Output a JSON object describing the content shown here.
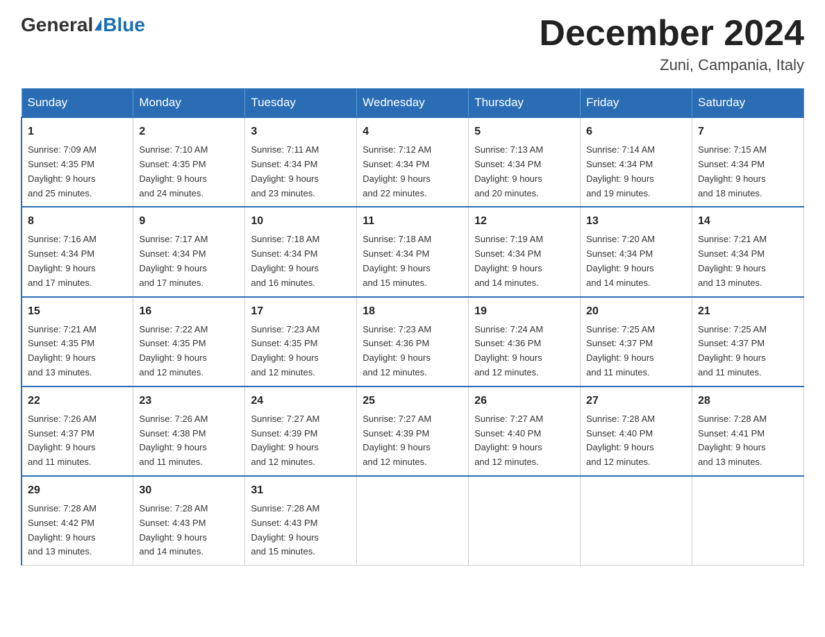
{
  "logo": {
    "general": "General",
    "blue": "Blue"
  },
  "header": {
    "month": "December 2024",
    "location": "Zuni, Campania, Italy"
  },
  "weekdays": [
    "Sunday",
    "Monday",
    "Tuesday",
    "Wednesday",
    "Thursday",
    "Friday",
    "Saturday"
  ],
  "weeks": [
    [
      {
        "day": "1",
        "sunrise": "7:09 AM",
        "sunset": "4:35 PM",
        "daylight": "9 hours and 25 minutes."
      },
      {
        "day": "2",
        "sunrise": "7:10 AM",
        "sunset": "4:35 PM",
        "daylight": "9 hours and 24 minutes."
      },
      {
        "day": "3",
        "sunrise": "7:11 AM",
        "sunset": "4:34 PM",
        "daylight": "9 hours and 23 minutes."
      },
      {
        "day": "4",
        "sunrise": "7:12 AM",
        "sunset": "4:34 PM",
        "daylight": "9 hours and 22 minutes."
      },
      {
        "day": "5",
        "sunrise": "7:13 AM",
        "sunset": "4:34 PM",
        "daylight": "9 hours and 20 minutes."
      },
      {
        "day": "6",
        "sunrise": "7:14 AM",
        "sunset": "4:34 PM",
        "daylight": "9 hours and 19 minutes."
      },
      {
        "day": "7",
        "sunrise": "7:15 AM",
        "sunset": "4:34 PM",
        "daylight": "9 hours and 18 minutes."
      }
    ],
    [
      {
        "day": "8",
        "sunrise": "7:16 AM",
        "sunset": "4:34 PM",
        "daylight": "9 hours and 17 minutes."
      },
      {
        "day": "9",
        "sunrise": "7:17 AM",
        "sunset": "4:34 PM",
        "daylight": "9 hours and 17 minutes."
      },
      {
        "day": "10",
        "sunrise": "7:18 AM",
        "sunset": "4:34 PM",
        "daylight": "9 hours and 16 minutes."
      },
      {
        "day": "11",
        "sunrise": "7:18 AM",
        "sunset": "4:34 PM",
        "daylight": "9 hours and 15 minutes."
      },
      {
        "day": "12",
        "sunrise": "7:19 AM",
        "sunset": "4:34 PM",
        "daylight": "9 hours and 14 minutes."
      },
      {
        "day": "13",
        "sunrise": "7:20 AM",
        "sunset": "4:34 PM",
        "daylight": "9 hours and 14 minutes."
      },
      {
        "day": "14",
        "sunrise": "7:21 AM",
        "sunset": "4:34 PM",
        "daylight": "9 hours and 13 minutes."
      }
    ],
    [
      {
        "day": "15",
        "sunrise": "7:21 AM",
        "sunset": "4:35 PM",
        "daylight": "9 hours and 13 minutes."
      },
      {
        "day": "16",
        "sunrise": "7:22 AM",
        "sunset": "4:35 PM",
        "daylight": "9 hours and 12 minutes."
      },
      {
        "day": "17",
        "sunrise": "7:23 AM",
        "sunset": "4:35 PM",
        "daylight": "9 hours and 12 minutes."
      },
      {
        "day": "18",
        "sunrise": "7:23 AM",
        "sunset": "4:36 PM",
        "daylight": "9 hours and 12 minutes."
      },
      {
        "day": "19",
        "sunrise": "7:24 AM",
        "sunset": "4:36 PM",
        "daylight": "9 hours and 12 minutes."
      },
      {
        "day": "20",
        "sunrise": "7:25 AM",
        "sunset": "4:37 PM",
        "daylight": "9 hours and 11 minutes."
      },
      {
        "day": "21",
        "sunrise": "7:25 AM",
        "sunset": "4:37 PM",
        "daylight": "9 hours and 11 minutes."
      }
    ],
    [
      {
        "day": "22",
        "sunrise": "7:26 AM",
        "sunset": "4:37 PM",
        "daylight": "9 hours and 11 minutes."
      },
      {
        "day": "23",
        "sunrise": "7:26 AM",
        "sunset": "4:38 PM",
        "daylight": "9 hours and 11 minutes."
      },
      {
        "day": "24",
        "sunrise": "7:27 AM",
        "sunset": "4:39 PM",
        "daylight": "9 hours and 12 minutes."
      },
      {
        "day": "25",
        "sunrise": "7:27 AM",
        "sunset": "4:39 PM",
        "daylight": "9 hours and 12 minutes."
      },
      {
        "day": "26",
        "sunrise": "7:27 AM",
        "sunset": "4:40 PM",
        "daylight": "9 hours and 12 minutes."
      },
      {
        "day": "27",
        "sunrise": "7:28 AM",
        "sunset": "4:40 PM",
        "daylight": "9 hours and 12 minutes."
      },
      {
        "day": "28",
        "sunrise": "7:28 AM",
        "sunset": "4:41 PM",
        "daylight": "9 hours and 13 minutes."
      }
    ],
    [
      {
        "day": "29",
        "sunrise": "7:28 AM",
        "sunset": "4:42 PM",
        "daylight": "9 hours and 13 minutes."
      },
      {
        "day": "30",
        "sunrise": "7:28 AM",
        "sunset": "4:43 PM",
        "daylight": "9 hours and 14 minutes."
      },
      {
        "day": "31",
        "sunrise": "7:28 AM",
        "sunset": "4:43 PM",
        "daylight": "9 hours and 15 minutes."
      },
      null,
      null,
      null,
      null
    ]
  ],
  "labels": {
    "sunrise": "Sunrise:",
    "sunset": "Sunset:",
    "daylight": "Daylight:"
  }
}
